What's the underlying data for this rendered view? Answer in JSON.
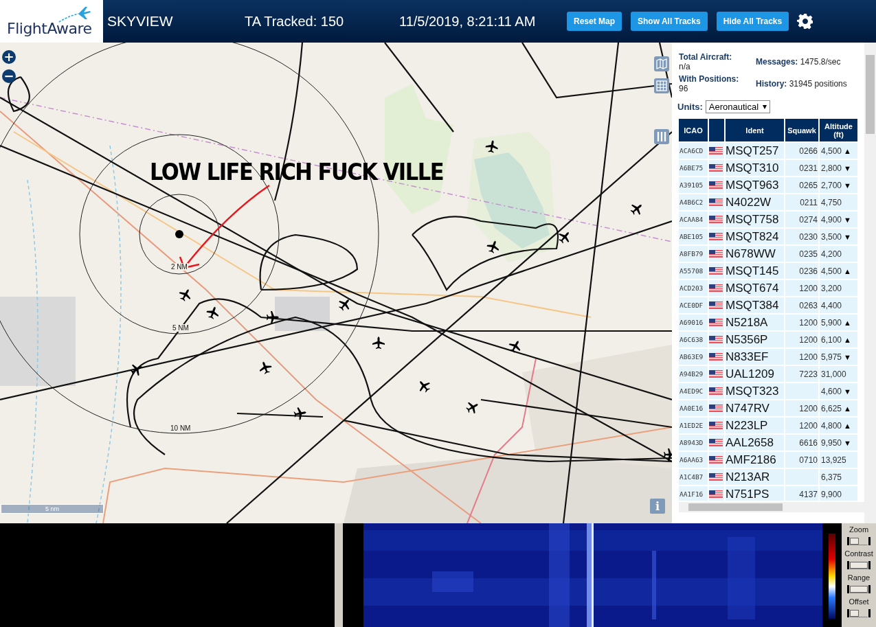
{
  "header": {
    "logo": "FlightAware",
    "title": "SKYVIEW",
    "tracked": "TA Tracked: 150",
    "datetime": "11/5/2019, 8:21:11 AM",
    "buttons": [
      "Reset Map",
      "Show All Tracks",
      "Hide All Tracks"
    ]
  },
  "map": {
    "kind": "picture",
    "zoom_buttons": [
      "+",
      "−"
    ],
    "range_labels": [
      "2 NM",
      "5 NM",
      "10 NM"
    ],
    "scale": "5 nm",
    "info_button": "i",
    "annotation": "LOW LIFE RICH FUCK VILLE"
  },
  "stats": [
    {
      "label": "Total Aircraft:",
      "value": "n/a"
    },
    {
      "label": "Messages:",
      "value": "1475.8/sec"
    },
    {
      "label": "With Positions:",
      "value": "96"
    },
    {
      "label": "History:",
      "value": "31945 positions"
    }
  ],
  "units": {
    "label": "Units:",
    "value": "Aeronautical"
  },
  "table": {
    "columns": [
      "ICAO",
      "Ident",
      "Squawk",
      "Altitude (ft)"
    ],
    "rows": [
      {
        "icao": "ACA6CD",
        "ident": "MSQT257",
        "squawk": "0266",
        "altitude": "4,500",
        "trend": "▲"
      },
      {
        "icao": "A6BE75",
        "ident": "MSQT310",
        "squawk": "0231",
        "altitude": "2,800",
        "trend": "▼"
      },
      {
        "icao": "A39105",
        "ident": "MSQT963",
        "squawk": "0265",
        "altitude": "2,700",
        "trend": "▼"
      },
      {
        "icao": "A4B6C2",
        "ident": "N4022W",
        "squawk": "0211",
        "altitude": "4,750"
      },
      {
        "icao": "ACAA84",
        "ident": "MSQT758",
        "squawk": "0274",
        "altitude": "4,900",
        "trend": "▼"
      },
      {
        "icao": "ABE105",
        "ident": "MSQT824",
        "squawk": "0230",
        "altitude": "3,500",
        "trend": "▼"
      },
      {
        "icao": "A8FB79",
        "ident": "N678WW",
        "squawk": "0235",
        "altitude": "4,200"
      },
      {
        "icao": "A55708",
        "ident": "MSQT145",
        "squawk": "0236",
        "altitude": "4,500",
        "trend": "▲"
      },
      {
        "icao": "ACD203",
        "ident": "MSQT674",
        "squawk": "1200",
        "altitude": "3,200"
      },
      {
        "icao": "ACE0DF",
        "ident": "MSQT384",
        "squawk": "0263",
        "altitude": "4,400"
      },
      {
        "icao": "A69016",
        "ident": "N5218A",
        "squawk": "1200",
        "altitude": "5,900",
        "trend": "▲"
      },
      {
        "icao": "A6C638",
        "ident": "N5356P",
        "squawk": "1200",
        "altitude": "6,100",
        "trend": "▲"
      },
      {
        "icao": "AB63E9",
        "ident": "N833EF",
        "squawk": "1200",
        "altitude": "5,975",
        "trend": "▼"
      },
      {
        "icao": "A94B29",
        "ident": "UAL1209",
        "squawk": "7223",
        "altitude": "31,000"
      },
      {
        "icao": "A4ED9C",
        "ident": "MSQT323",
        "altitude": "4,600",
        "trend": "▼"
      },
      {
        "icao": "AA0E16",
        "ident": "N747RV",
        "squawk": "1200",
        "altitude": "6,625",
        "trend": "▲"
      },
      {
        "icao": "A1ED2E",
        "ident": "N223LP",
        "squawk": "1200",
        "altitude": "4,800",
        "trend": "▲"
      },
      {
        "icao": "A8943D",
        "ident": "AAL2658",
        "squawk": "6616",
        "altitude": "9,950",
        "trend": "▼"
      },
      {
        "icao": "A6AA63",
        "ident": "AMF2186",
        "squawk": "0710",
        "altitude": "13,925"
      },
      {
        "icao": "A1C4B7",
        "ident": "N213AR",
        "altitude": "6,375"
      },
      {
        "icao": "AA1F16",
        "ident": "N751PS",
        "squawk": "4137",
        "altitude": "9,900"
      }
    ]
  },
  "waterfall": {
    "kind": "picture",
    "controls": [
      {
        "label": "Zoom",
        "level": 0.5
      },
      {
        "label": "Contrast",
        "level": 1
      },
      {
        "label": "Range",
        "level": 1
      },
      {
        "label": "Offset",
        "level": 0.5
      }
    ]
  }
}
